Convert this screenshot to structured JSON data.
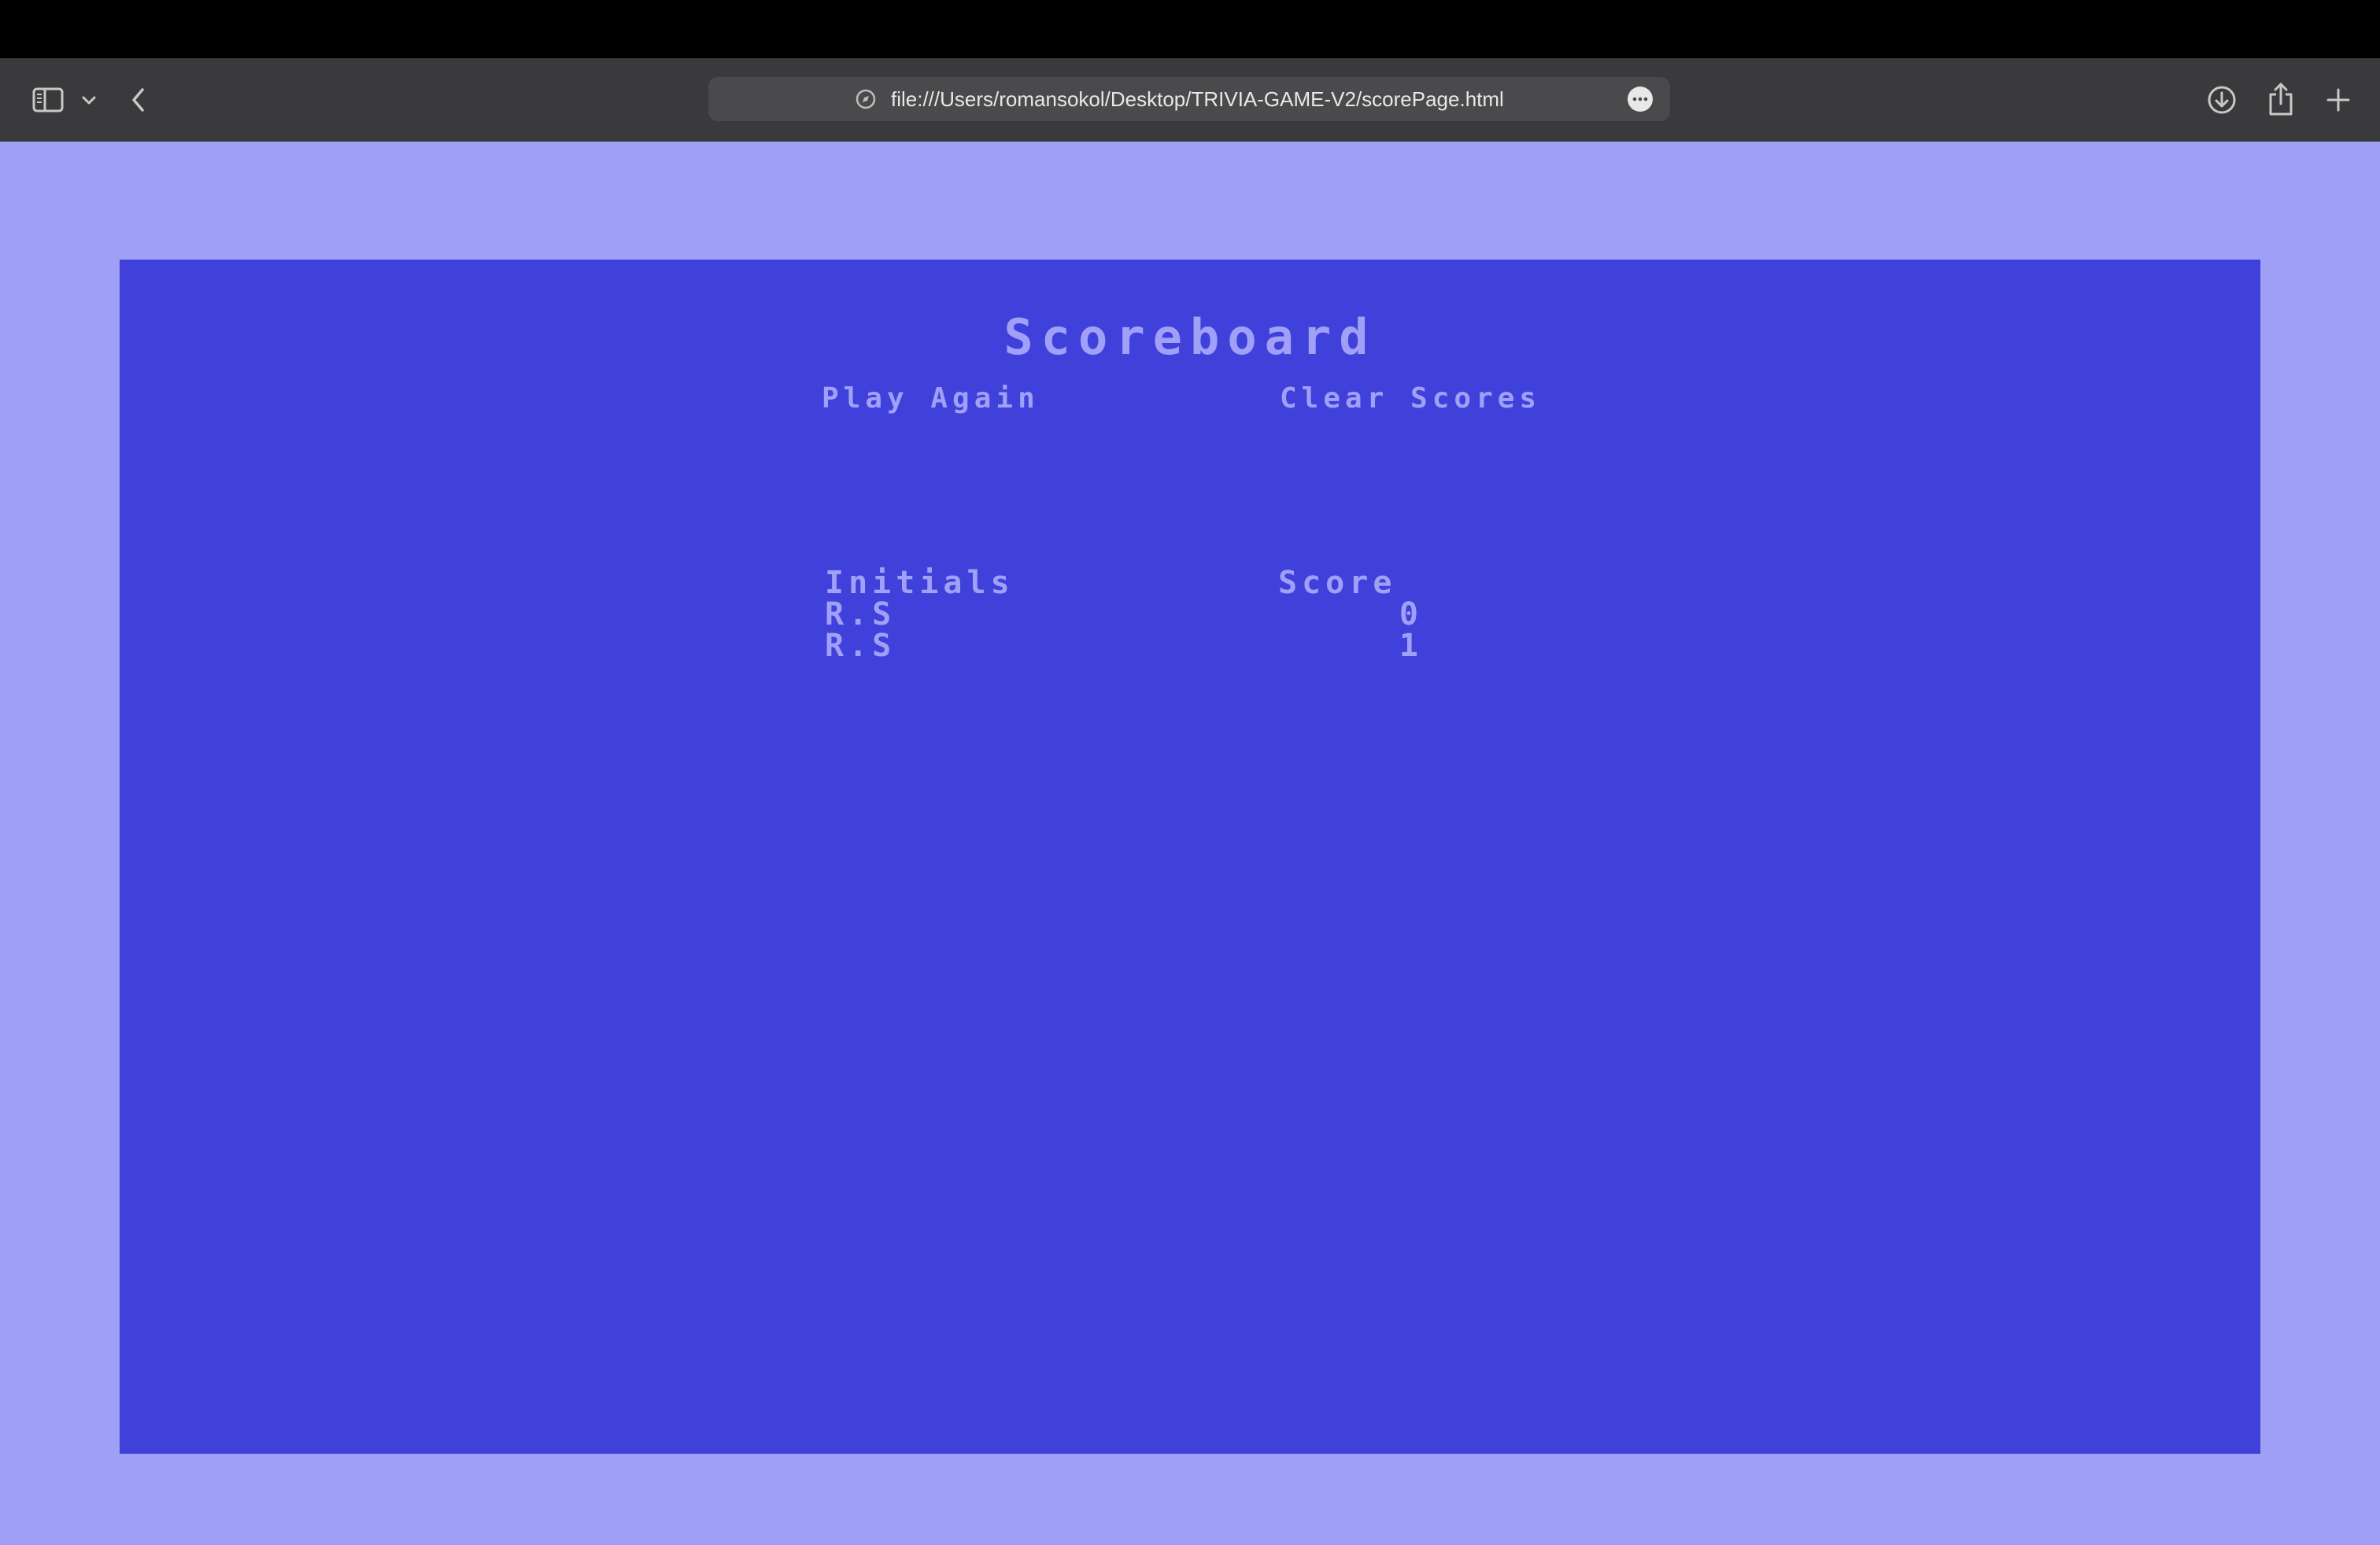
{
  "browser": {
    "address_url": "file:///Users/romansokol/Desktop/TRIVIA-GAME-V2/scorePage.html",
    "icons": {
      "sidebar": "sidebar-icon",
      "sidebar_menu": "chevron-down-icon",
      "back": "chevron-left-icon",
      "site": "compass-icon",
      "more": "ellipsis-icon",
      "download": "download-icon",
      "share": "share-icon",
      "new_tab": "plus-icon"
    }
  },
  "page": {
    "title": "Scoreboard",
    "play_again_label": "Play Again",
    "clear_scores_label": "Clear Scores",
    "table": {
      "headers": {
        "initials": "Initials",
        "score": "Score"
      },
      "rows": [
        {
          "initials": "R.S",
          "score": "0"
        },
        {
          "initials": "R.S",
          "score": "1"
        }
      ]
    }
  },
  "colors": {
    "page_background": "#9f9ff5",
    "panel_background": "#4040da",
    "text": "#a0a0f8",
    "toolbar": "#3a3a3c"
  }
}
